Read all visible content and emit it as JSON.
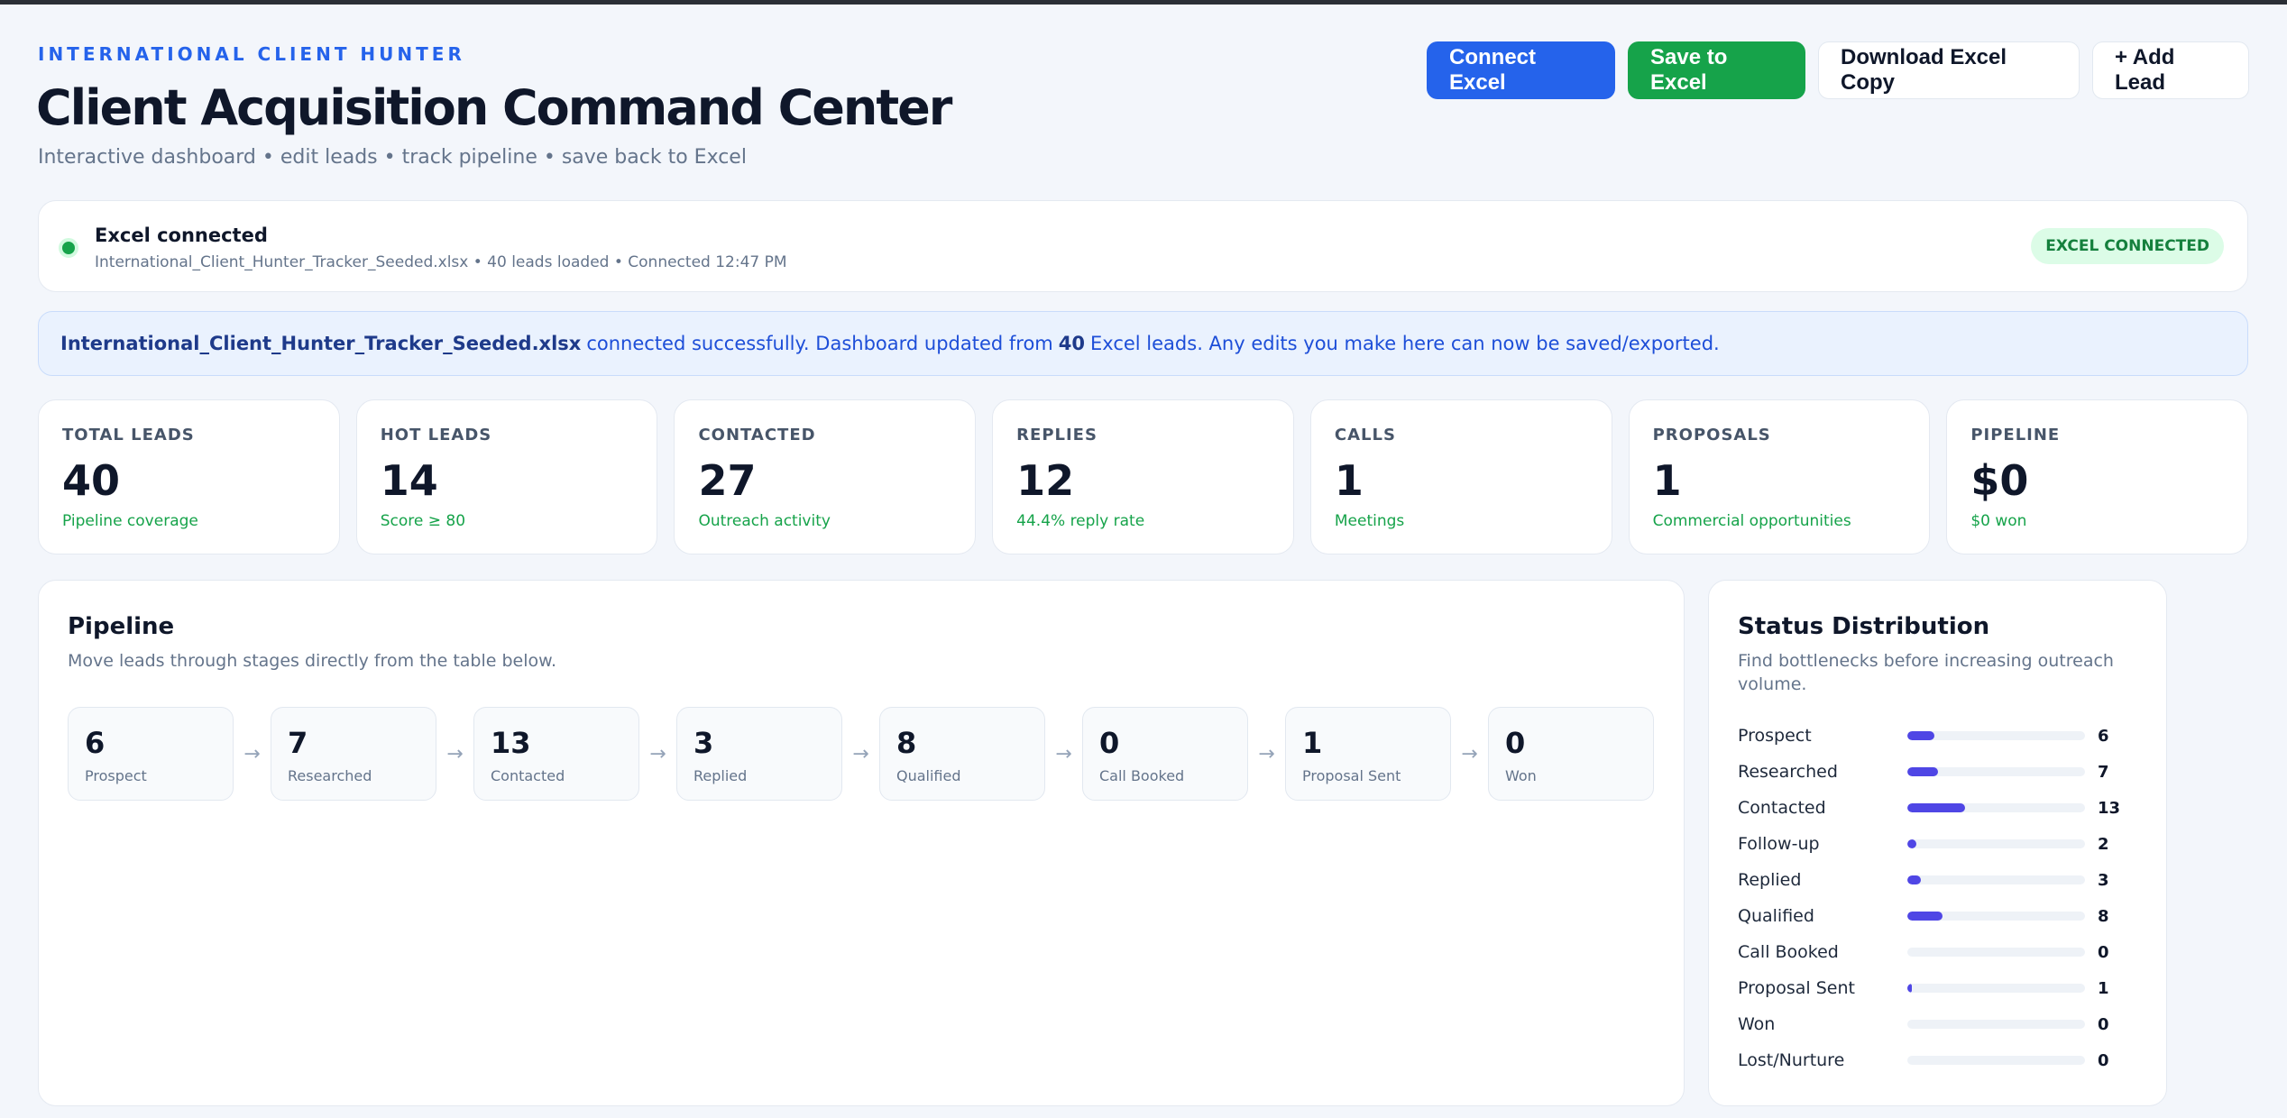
{
  "header": {
    "eyebrow": "INTERNATIONAL CLIENT HUNTER",
    "title": "Client Acquisition Command Center",
    "subtitle": "Interactive dashboard • edit leads • track pipeline • save back to Excel"
  },
  "actions": {
    "connect": "Connect Excel",
    "save": "Save to Excel",
    "download": "Download Excel Copy",
    "add": "+ Add Lead"
  },
  "connection": {
    "title": "Excel connected",
    "details": "International_Client_Hunter_Tracker_Seeded.xlsx • 40 leads loaded • Connected 12:47 PM",
    "badge": "EXCEL CONNECTED"
  },
  "notice": {
    "file": "International_Client_Hunter_Tracker_Seeded.xlsx",
    "text_before": "connected successfully. Dashboard updated from",
    "count": "40",
    "text_after": "Excel leads. Any edits you make here can now be saved/exported."
  },
  "stats": [
    {
      "label": "TOTAL LEADS",
      "value": "40",
      "note": "Pipeline coverage"
    },
    {
      "label": "HOT LEADS",
      "value": "14",
      "note": "Score ≥ 80"
    },
    {
      "label": "CONTACTED",
      "value": "27",
      "note": "Outreach activity"
    },
    {
      "label": "REPLIES",
      "value": "12",
      "note": "44.4% reply rate"
    },
    {
      "label": "CALLS",
      "value": "1",
      "note": "Meetings"
    },
    {
      "label": "PROPOSALS",
      "value": "1",
      "note": "Commercial opportunities"
    },
    {
      "label": "PIPELINE",
      "value": "$0",
      "note": "$0 won"
    }
  ],
  "pipeline": {
    "title": "Pipeline",
    "subtitle": "Move leads through stages directly from the table below.",
    "arrow": "→",
    "stages": [
      {
        "count": "6",
        "name": "Prospect"
      },
      {
        "count": "7",
        "name": "Researched"
      },
      {
        "count": "13",
        "name": "Contacted"
      },
      {
        "count": "3",
        "name": "Replied"
      },
      {
        "count": "8",
        "name": "Qualified"
      },
      {
        "count": "0",
        "name": "Call Booked"
      },
      {
        "count": "1",
        "name": "Proposal Sent"
      },
      {
        "count": "0",
        "name": "Won"
      }
    ]
  },
  "status": {
    "title": "Status Distribution",
    "subtitle": "Find bottlenecks before increasing outreach volume.",
    "max": 40,
    "accent": "#4f46e5",
    "rows": [
      {
        "label": "Prospect",
        "value": 6
      },
      {
        "label": "Researched",
        "value": 7
      },
      {
        "label": "Contacted",
        "value": 13
      },
      {
        "label": "Follow-up",
        "value": 2
      },
      {
        "label": "Replied",
        "value": 3
      },
      {
        "label": "Qualified",
        "value": 8
      },
      {
        "label": "Call Booked",
        "value": 0
      },
      {
        "label": "Proposal Sent",
        "value": 1
      },
      {
        "label": "Won",
        "value": 0
      },
      {
        "label": "Lost/Nurture",
        "value": 0
      }
    ]
  }
}
